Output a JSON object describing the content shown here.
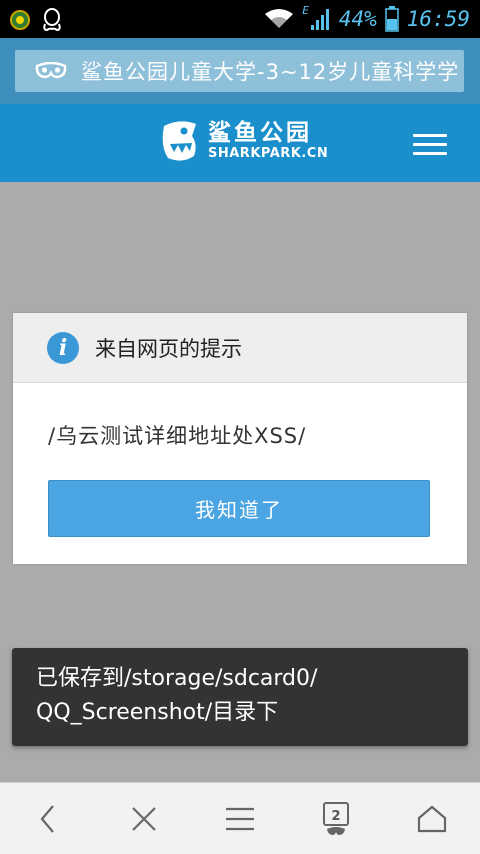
{
  "status_bar": {
    "battery_percent": "44%",
    "time": "16:59",
    "network_type": "E",
    "icons": [
      "app-icon",
      "qq-icon",
      "wifi-icon",
      "signal-icon",
      "battery-icon"
    ]
  },
  "browser": {
    "page_title": "鲨鱼公园儿童大学-3~12岁儿童科学学",
    "page_title_icon": "mask-icon"
  },
  "site_header": {
    "logo_cn": "鲨鱼公园",
    "logo_en": "SHARKPARK.CN",
    "menu_icon": "hamburger-icon"
  },
  "dialog": {
    "title": "来自网页的提示",
    "message": "/乌云测试详细地址处XSS/",
    "ok_button": "我知道了"
  },
  "toast": {
    "line1": "已保存到/storage/sdcard0/",
    "line2": "QQ_Screenshot/目录下"
  },
  "bottom_nav": {
    "tab_count": "2",
    "items": [
      "back-icon",
      "close-icon",
      "menu-icon",
      "tabs-icon",
      "home-icon"
    ]
  },
  "colors": {
    "title_bar": "#3e8fbe",
    "site_header": "#1a8fcc",
    "button": "#4aa5e2",
    "overlay": "#ababab"
  }
}
